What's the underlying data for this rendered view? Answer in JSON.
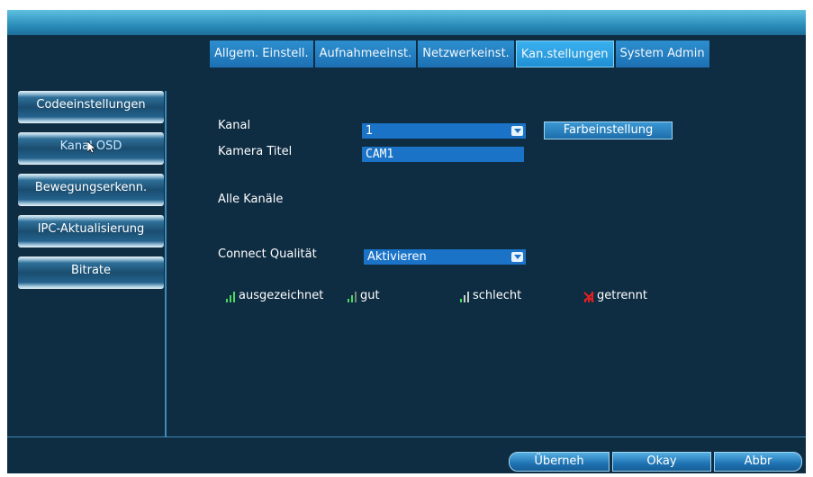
{
  "tabs": [
    "Allgem. Einstell.",
    "Aufnahmeeinst.",
    "Netzwerkeinst.",
    "Kan.stellungen",
    "System Admin"
  ],
  "sidebar": [
    "Codeeinstellungen",
    "Kanal OSD",
    "Bewegungserkenn.",
    "IPC-Aktualisierung",
    "Bitrate"
  ],
  "form": {
    "kanal_label": "Kanal",
    "kanal_value": "1",
    "farb_button": "Farbeinstellung",
    "titel_label": "Kamera Titel",
    "titel_value": "CAM1",
    "alle_label": "Alle Kanäle",
    "connect_label": "Connect Qualität",
    "connect_value": "Aktivieren"
  },
  "legend": {
    "excellent": "ausgezeichnet",
    "good": "gut",
    "bad": "schlecht",
    "disconnected": "getrennt"
  },
  "buttons": {
    "apply": "Überneh",
    "ok": "Okay",
    "cancel": "Abbr"
  },
  "colors": {
    "background": "#0e2c42",
    "signal_good": "#4cd964",
    "signal_disconnected": "#e02020"
  }
}
